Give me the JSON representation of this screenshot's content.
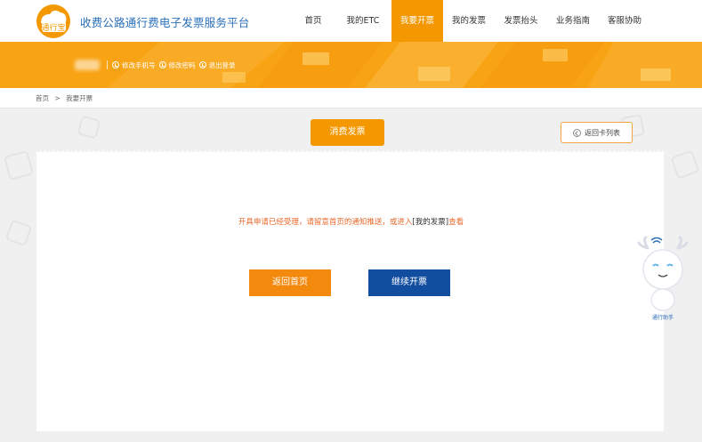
{
  "header": {
    "site_title": "收费公路通行费电子发票服务平台",
    "logo_text": "通行宝",
    "nav": [
      {
        "label": "首页"
      },
      {
        "label": "我的ETC"
      },
      {
        "label": "我要开票"
      },
      {
        "label": "我的发票"
      },
      {
        "label": "发票抬头"
      },
      {
        "label": "业务指南"
      },
      {
        "label": "客服协助"
      }
    ],
    "active_nav": "我要开票"
  },
  "banner": {
    "links": [
      {
        "label": "修改手机号"
      },
      {
        "label": "修改密码"
      },
      {
        "label": "退出登录"
      }
    ]
  },
  "breadcrumb": {
    "home": "首页",
    "separator": ">",
    "current": "我要开票"
  },
  "tabs": {
    "consume_invoice": "消费发票"
  },
  "back_button": "返回卡列表",
  "message": {
    "text": "开具申请已经受理，请留意首页的通知推送，或进入",
    "link": "[我的发票]",
    "suffix": "查看"
  },
  "buttons": {
    "home": "返回首页",
    "continue": "继续开票"
  },
  "mascot": {
    "label": "通行助手"
  },
  "colors": {
    "accent": "#f39800",
    "title_blue": "#2a6fb8",
    "continue_blue": "#124ea0",
    "message_orange": "#e8692a"
  }
}
